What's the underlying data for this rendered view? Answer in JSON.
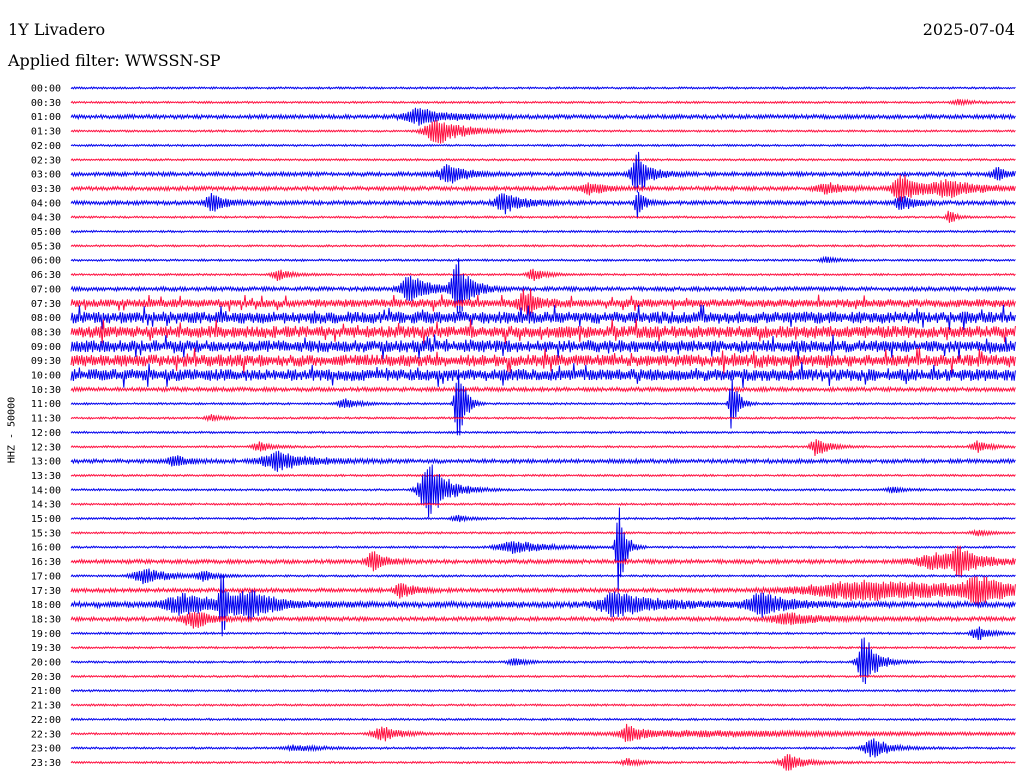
{
  "header": {
    "station": "1Y Livadero",
    "date": "2025-07-04",
    "filter_label": "Applied filter: WWSSN-SP"
  },
  "chart_data": {
    "type": "line",
    "title": "1Y Livadero",
    "ylabel": "HHZ - 50000",
    "row_labels": [
      "00:00",
      "00:30",
      "01:00",
      "01:30",
      "02:00",
      "02:30",
      "03:00",
      "03:30",
      "04:00",
      "04:30",
      "05:00",
      "05:30",
      "06:00",
      "06:30",
      "07:00",
      "07:30",
      "08:00",
      "08:30",
      "09:00",
      "09:30",
      "10:00",
      "10:30",
      "11:00",
      "11:30",
      "12:00",
      "12:30",
      "13:00",
      "13:30",
      "14:00",
      "14:30",
      "15:00",
      "15:30",
      "16:00",
      "16:30",
      "17:00",
      "17:30",
      "18:00",
      "18:30",
      "19:00",
      "19:30",
      "20:00",
      "20:30",
      "21:00",
      "21:30",
      "22:00",
      "22:30",
      "23:00",
      "23:30"
    ],
    "series_colors": {
      "even_rows": "#0000ee",
      "odd_rows": "#ff1040"
    },
    "noise_level": [
      1,
      1,
      2,
      1,
      1,
      1,
      2,
      2,
      2,
      1,
      1,
      1,
      1,
      1,
      2,
      4,
      6,
      6,
      6,
      6,
      6,
      2,
      1,
      1,
      1,
      1,
      2,
      1,
      1,
      1,
      1,
      1,
      1,
      2,
      1,
      2,
      3,
      2,
      1,
      1,
      1,
      1,
      1,
      1,
      1,
      1,
      1,
      1
    ],
    "events": [
      {
        "row": 1,
        "x": 0.94,
        "amp": 3,
        "dur": 0.02
      },
      {
        "row": 2,
        "x": 0.37,
        "amp": 8,
        "dur": 0.05
      },
      {
        "row": 3,
        "x": 0.39,
        "amp": 14,
        "dur": 0.04
      },
      {
        "row": 6,
        "x": 0.4,
        "amp": 10,
        "dur": 0.03
      },
      {
        "row": 6,
        "x": 0.6,
        "amp": 22,
        "dur": 0.02
      },
      {
        "row": 6,
        "x": 0.98,
        "amp": 6,
        "dur": 0.02
      },
      {
        "row": 7,
        "x": 0.55,
        "amp": 6,
        "dur": 0.03
      },
      {
        "row": 7,
        "x": 0.8,
        "amp": 6,
        "dur": 0.03
      },
      {
        "row": 7,
        "x": 0.88,
        "amp": 14,
        "dur": 0.03
      },
      {
        "row": 7,
        "x": 0.93,
        "amp": 8,
        "dur": 0.05
      },
      {
        "row": 8,
        "x": 0.15,
        "amp": 10,
        "dur": 0.02
      },
      {
        "row": 8,
        "x": 0.46,
        "amp": 10,
        "dur": 0.03
      },
      {
        "row": 8,
        "x": 0.6,
        "amp": 16,
        "dur": 0.01
      },
      {
        "row": 8,
        "x": 0.88,
        "amp": 8,
        "dur": 0.02
      },
      {
        "row": 9,
        "x": 0.93,
        "amp": 8,
        "dur": 0.01
      },
      {
        "row": 12,
        "x": 0.8,
        "amp": 3,
        "dur": 0.02
      },
      {
        "row": 13,
        "x": 0.22,
        "amp": 6,
        "dur": 0.02
      },
      {
        "row": 13,
        "x": 0.49,
        "amp": 6,
        "dur": 0.02
      },
      {
        "row": 14,
        "x": 0.36,
        "amp": 14,
        "dur": 0.03
      },
      {
        "row": 14,
        "x": 0.41,
        "amp": 30,
        "dur": 0.02
      },
      {
        "row": 15,
        "x": 0.48,
        "amp": 12,
        "dur": 0.02
      },
      {
        "row": 22,
        "x": 0.29,
        "amp": 6,
        "dur": 0.02
      },
      {
        "row": 22,
        "x": 0.41,
        "amp": 55,
        "dur": 0.01
      },
      {
        "row": 22,
        "x": 0.7,
        "amp": 30,
        "dur": 0.01
      },
      {
        "row": 23,
        "x": 0.15,
        "amp": 3,
        "dur": 0.02
      },
      {
        "row": 25,
        "x": 0.2,
        "amp": 5,
        "dur": 0.02
      },
      {
        "row": 25,
        "x": 0.79,
        "amp": 10,
        "dur": 0.02
      },
      {
        "row": 25,
        "x": 0.96,
        "amp": 6,
        "dur": 0.02
      },
      {
        "row": 26,
        "x": 0.11,
        "amp": 6,
        "dur": 0.02
      },
      {
        "row": 26,
        "x": 0.22,
        "amp": 10,
        "dur": 0.05
      },
      {
        "row": 28,
        "x": 0.38,
        "amp": 30,
        "dur": 0.03
      },
      {
        "row": 28,
        "x": 0.87,
        "amp": 3,
        "dur": 0.02
      },
      {
        "row": 30,
        "x": 0.41,
        "amp": 3,
        "dur": 0.02
      },
      {
        "row": 31,
        "x": 0.96,
        "amp": 3,
        "dur": 0.02
      },
      {
        "row": 32,
        "x": 0.47,
        "amp": 7,
        "dur": 0.05
      },
      {
        "row": 32,
        "x": 0.58,
        "amp": 50,
        "dur": 0.01
      },
      {
        "row": 33,
        "x": 0.32,
        "amp": 10,
        "dur": 0.02
      },
      {
        "row": 33,
        "x": 0.92,
        "amp": 8,
        "dur": 0.08
      },
      {
        "row": 33,
        "x": 0.94,
        "amp": 12,
        "dur": 0.02
      },
      {
        "row": 34,
        "x": 0.08,
        "amp": 8,
        "dur": 0.04
      },
      {
        "row": 34,
        "x": 0.14,
        "amp": 5,
        "dur": 0.02
      },
      {
        "row": 35,
        "x": 0.35,
        "amp": 8,
        "dur": 0.02
      },
      {
        "row": 35,
        "x": 0.85,
        "amp": 10,
        "dur": 0.2
      },
      {
        "row": 35,
        "x": 0.96,
        "amp": 12,
        "dur": 0.04
      },
      {
        "row": 36,
        "x": 0.12,
        "amp": 10,
        "dur": 0.06
      },
      {
        "row": 36,
        "x": 0.19,
        "amp": 14,
        "dur": 0.04
      },
      {
        "row": 36,
        "x": 0.16,
        "amp": 30,
        "dur": 0.01
      },
      {
        "row": 36,
        "x": 0.58,
        "amp": 12,
        "dur": 0.06
      },
      {
        "row": 36,
        "x": 0.73,
        "amp": 12,
        "dur": 0.04
      },
      {
        "row": 37,
        "x": 0.13,
        "amp": 10,
        "dur": 0.03
      },
      {
        "row": 37,
        "x": 0.76,
        "amp": 6,
        "dur": 0.05
      },
      {
        "row": 38,
        "x": 0.96,
        "amp": 8,
        "dur": 0.02
      },
      {
        "row": 40,
        "x": 0.47,
        "amp": 4,
        "dur": 0.02
      },
      {
        "row": 40,
        "x": 0.84,
        "amp": 30,
        "dur": 0.02
      },
      {
        "row": 45,
        "x": 0.33,
        "amp": 8,
        "dur": 0.03
      },
      {
        "row": 45,
        "x": 0.59,
        "amp": 10,
        "dur": 0.02
      },
      {
        "row": 45,
        "x": 0.68,
        "amp": 3,
        "dur": 0.3
      },
      {
        "row": 46,
        "x": 0.24,
        "amp": 3,
        "dur": 0.04
      },
      {
        "row": 46,
        "x": 0.85,
        "amp": 10,
        "dur": 0.03
      },
      {
        "row": 47,
        "x": 0.59,
        "amp": 4,
        "dur": 0.02
      },
      {
        "row": 47,
        "x": 0.76,
        "amp": 8,
        "dur": 0.03
      }
    ]
  }
}
